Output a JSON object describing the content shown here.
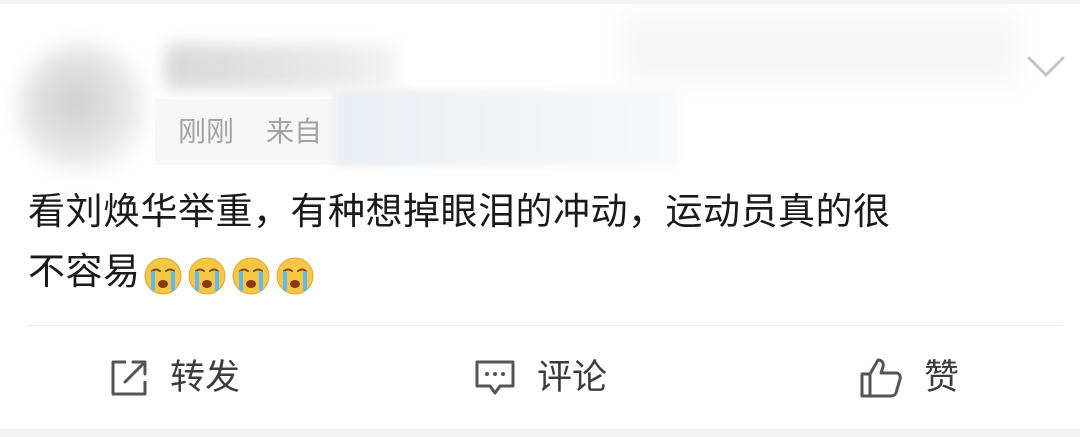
{
  "post": {
    "meta": {
      "time": "刚刚",
      "from_prefix": "来自"
    },
    "content": {
      "line1": "看刘焕华举重，有种想掉眼泪的冲动，运动员真的很",
      "line2": "不容易",
      "emoji_icons": [
        "cry-emoji",
        "cry-emoji",
        "cry-emoji",
        "cry-emoji"
      ]
    },
    "actions": {
      "repost_label": "转发",
      "comment_label": "评论",
      "like_label": "赞"
    }
  },
  "colors": {
    "text_primary": "#1a1a1a",
    "text_meta": "#a3a3a3",
    "action_text": "#3c3c3c",
    "divider": "#ebebeb",
    "emoji_face": "#f7c744"
  }
}
